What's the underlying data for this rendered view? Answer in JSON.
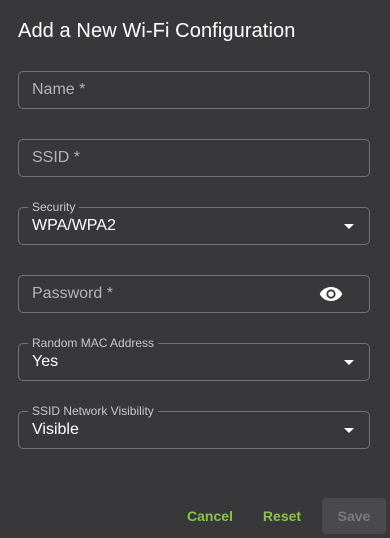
{
  "dialog": {
    "title": "Add a New Wi-Fi Configuration"
  },
  "fields": {
    "name": {
      "placeholder": "Name *",
      "value": ""
    },
    "ssid": {
      "placeholder": "SSID *",
      "value": ""
    },
    "security": {
      "label": "Security",
      "selected": "WPA/WPA2"
    },
    "password": {
      "placeholder": "Password *",
      "value": "",
      "toggle_icon": "eye-icon"
    },
    "random_mac": {
      "label": "Random MAC Address",
      "selected": "Yes"
    },
    "ssid_visibility": {
      "label": "SSID Network Visibility",
      "selected": "Visible"
    }
  },
  "actions": {
    "cancel_label": "Cancel",
    "reset_label": "Reset",
    "save_label": "Save",
    "save_disabled": true
  },
  "colors": {
    "accent": "#8bc34a",
    "dialog_bg": "#38383b",
    "disabled_bg": "#4a4a4e",
    "disabled_text": "#7c7c80"
  }
}
